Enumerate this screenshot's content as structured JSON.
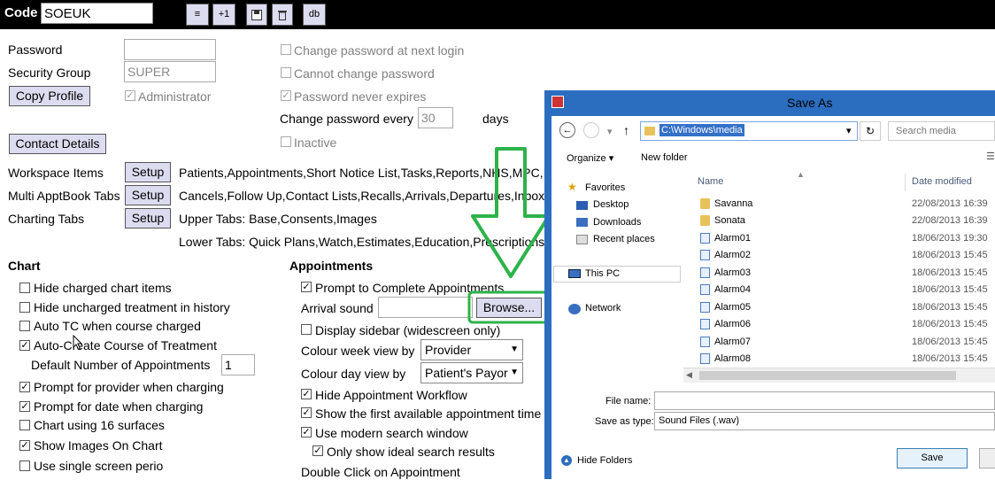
{
  "topbar": {
    "code_label": "Code",
    "code_value": "SOEUK",
    "buttons": [
      "≡",
      "+1",
      "",
      "",
      "db"
    ]
  },
  "left": {
    "password_label": "Password",
    "security_group_label": "Security Group",
    "security_group_value": "SUPER",
    "copy_profile": "Copy Profile",
    "administrator": "Administrator",
    "contact_details": "Contact Details"
  },
  "pwopts": {
    "change_next": "Change password at next login",
    "cannot_change": "Cannot change password",
    "never_expires": "Password never expires",
    "change_every": "Change password every",
    "days_value": "30",
    "days": "days",
    "inactive": "Inactive"
  },
  "setup": {
    "button": "Setup",
    "workspace_label": "Workspace Items",
    "workspace_value": "Patients,Appointments,Short Notice List,Tasks,Reports,NHS,MPC,I",
    "multi_label": "Multi ApptBook Tabs",
    "multi_value": "Cancels,Follow Up,Contact Lists,Recalls,Arrivals,Departures,Inbox,C",
    "charting_label": "Charting Tabs",
    "upper_value": "Upper Tabs: Base,Consents,Images",
    "lower_value": "Lower Tabs: Quick Plans,Watch,Estimates,Education,Prescriptions"
  },
  "chart": {
    "heading": "Chart",
    "items": [
      {
        "label": "Hide charged chart items",
        "checked": false
      },
      {
        "label": "Hide uncharged treatment in history",
        "checked": false
      },
      {
        "label": "Auto TC when course charged",
        "checked": false
      },
      {
        "label": "Auto-Create Course of Treatment",
        "checked": true
      }
    ],
    "default_num_label": "Default Number of Appointments",
    "default_num_value": "1",
    "items2": [
      {
        "label": "Prompt for provider when charging",
        "checked": true
      },
      {
        "label": "Prompt for date when charging",
        "checked": true
      },
      {
        "label": "Chart using 16 surfaces",
        "checked": false
      },
      {
        "label": "Show Images On Chart",
        "checked": true
      },
      {
        "label": "Use single screen perio",
        "checked": false
      }
    ]
  },
  "appointments": {
    "heading": "Appointments",
    "prompt_complete": "Prompt to Complete Appointments",
    "arrival_sound": "Arrival sound",
    "browse": "Browse...",
    "display_sidebar": "Display sidebar (widescreen only)",
    "colour_week": "Colour week view by",
    "colour_week_value": "Provider",
    "colour_day": "Colour day view by",
    "colour_day_value": "Patient's Payor",
    "hide_workflow": "Hide Appointment Workflow",
    "show_first": "Show the first available appointment time",
    "modern_search": "Use modern search window",
    "ideal_results": "Only show ideal search results",
    "double_click": "Double Click on Appointment"
  },
  "dialog": {
    "title": "Save As",
    "path": "C:\\Windows\\media",
    "search_placeholder": "Search media",
    "organize": "Organize",
    "new_folder": "New folder",
    "nav": [
      "Favorites",
      "Desktop",
      "Downloads",
      "Recent places",
      "This PC",
      "Network"
    ],
    "col_name": "Name",
    "col_date": "Date modified",
    "files": [
      {
        "name": "Savanna",
        "date": "22/08/2013 16:39",
        "type": "folder"
      },
      {
        "name": "Sonata",
        "date": "22/08/2013 16:39",
        "type": "folder"
      },
      {
        "name": "Alarm01",
        "date": "18/06/2013 19:30",
        "type": "sound"
      },
      {
        "name": "Alarm02",
        "date": "18/06/2013 15:45",
        "type": "sound"
      },
      {
        "name": "Alarm03",
        "date": "18/06/2013 15:45",
        "type": "sound"
      },
      {
        "name": "Alarm04",
        "date": "18/06/2013 15:45",
        "type": "sound"
      },
      {
        "name": "Alarm05",
        "date": "18/06/2013 15:45",
        "type": "sound"
      },
      {
        "name": "Alarm06",
        "date": "18/06/2013 15:45",
        "type": "sound"
      },
      {
        "name": "Alarm07",
        "date": "18/06/2013 15:45",
        "type": "sound"
      },
      {
        "name": "Alarm08",
        "date": "18/06/2013 15:45",
        "type": "sound"
      }
    ],
    "file_name_label": "File name:",
    "save_type_label": "Save as type:",
    "save_type_value": "Sound Files (.wav)",
    "hide_folders": "Hide Folders",
    "save": "Save"
  },
  "colors": {
    "annotation_green": "#2db34a",
    "dialog_title": "#2b6dbf",
    "button_bg": "#dcdcf0"
  }
}
